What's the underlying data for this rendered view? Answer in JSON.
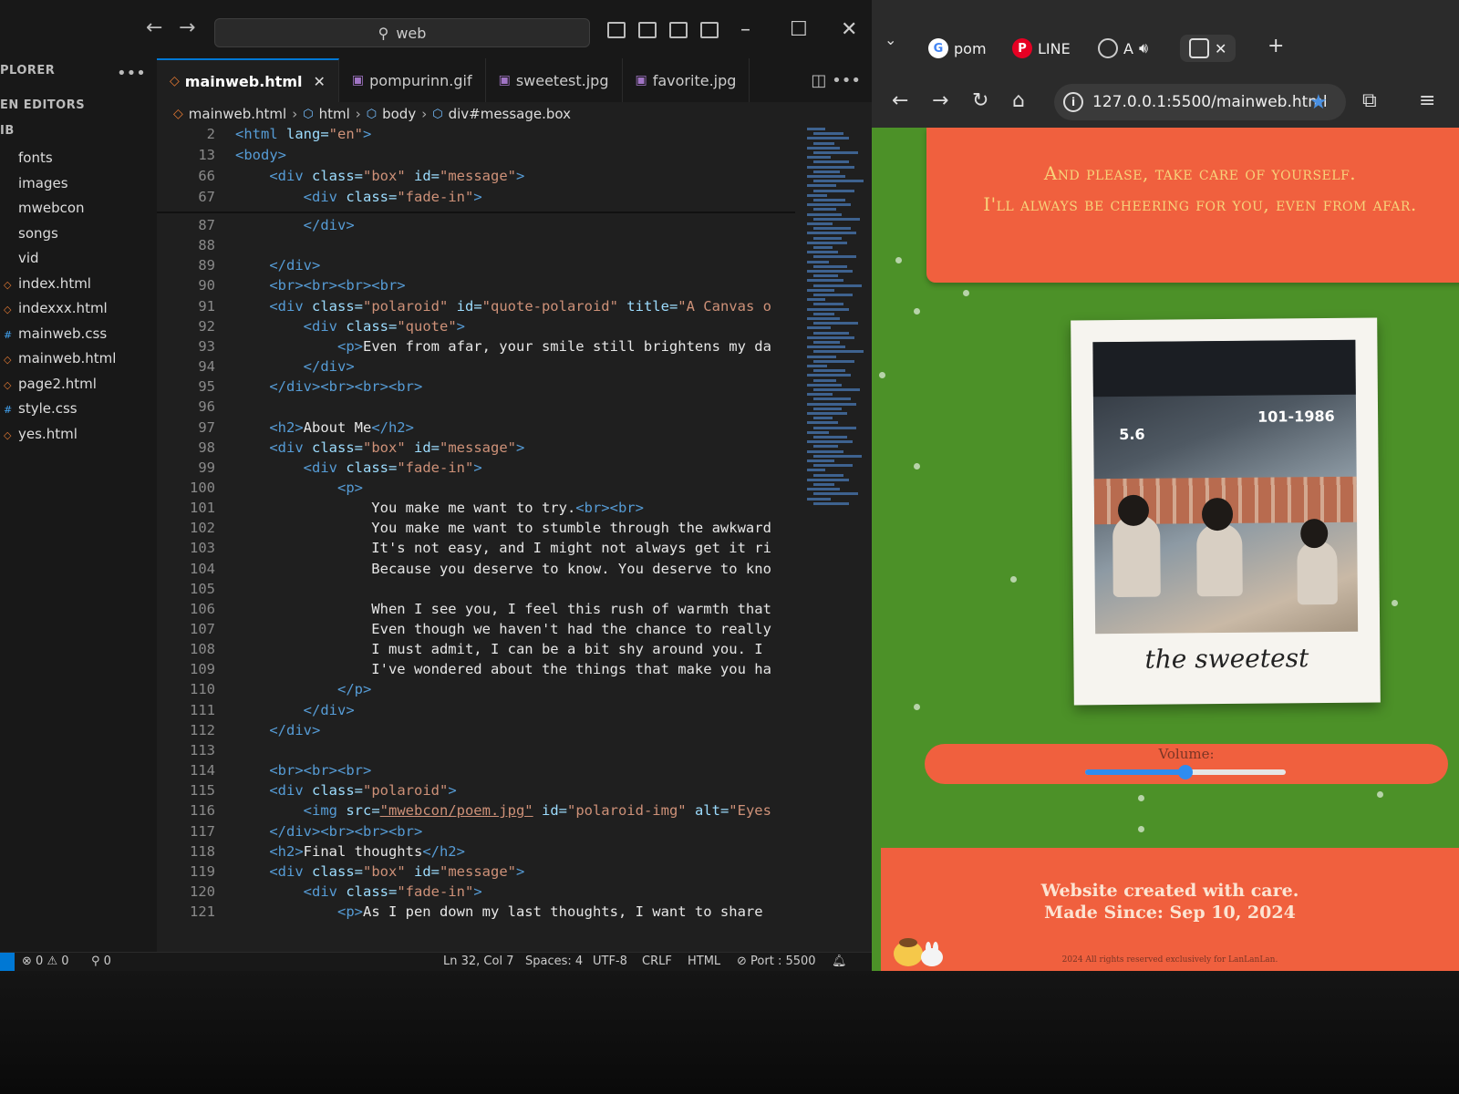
{
  "vscode": {
    "search_text": "web",
    "explorer": {
      "title": "PLORER",
      "open_editors": "EN EDITORS",
      "folder": "IB",
      "items": [
        "fonts",
        "images",
        "mwebcon",
        "songs",
        "vid",
        "index.html",
        "indexxx.html",
        "mainweb.css",
        "mainweb.html",
        "page2.html",
        "style.css",
        "yes.html"
      ]
    },
    "tabs": [
      "mainweb.html",
      "pompurinn.gif",
      "sweetest.jpg",
      "favorite.jpg"
    ],
    "breadcrumb": [
      "mainweb.html",
      "html",
      "body",
      "div#message.box"
    ],
    "code_lines": [
      {
        "n": "2",
        "s": [
          [
            "t",
            "<html "
          ],
          [
            "a",
            "lang="
          ],
          [
            "s",
            "\"en\""
          ],
          [
            "t",
            ">"
          ]
        ]
      },
      {
        "n": "13",
        "s": [
          [
            "t",
            "<body>"
          ]
        ]
      },
      {
        "n": "66",
        "s": [
          [
            "x",
            "    "
          ],
          [
            "t",
            "<div "
          ],
          [
            "a",
            "class="
          ],
          [
            "s",
            "\"box\" "
          ],
          [
            "a",
            "id="
          ],
          [
            "s",
            "\"message\""
          ],
          [
            "t",
            ">"
          ]
        ]
      },
      {
        "n": "67",
        "s": [
          [
            "x",
            "        "
          ],
          [
            "t",
            "<div "
          ],
          [
            "a",
            "class="
          ],
          [
            "s",
            "\"fade-in\""
          ],
          [
            "t",
            ">"
          ]
        ]
      },
      {
        "n": "87",
        "s": [
          [
            "x",
            "        "
          ],
          [
            "t",
            "</div>"
          ]
        ]
      },
      {
        "n": "88",
        "s": []
      },
      {
        "n": "89",
        "s": [
          [
            "x",
            "    "
          ],
          [
            "t",
            "</div>"
          ]
        ]
      },
      {
        "n": "90",
        "s": [
          [
            "x",
            "    "
          ],
          [
            "t",
            "<br><br><br><br>"
          ]
        ]
      },
      {
        "n": "91",
        "s": [
          [
            "x",
            "    "
          ],
          [
            "t",
            "<div "
          ],
          [
            "a",
            "class="
          ],
          [
            "s",
            "\"polaroid\" "
          ],
          [
            "a",
            "id="
          ],
          [
            "s",
            "\"quote-polaroid\" "
          ],
          [
            "a",
            "title="
          ],
          [
            "s",
            "\"A Canvas o"
          ]
        ]
      },
      {
        "n": "92",
        "s": [
          [
            "x",
            "        "
          ],
          [
            "t",
            "<div "
          ],
          [
            "a",
            "class="
          ],
          [
            "s",
            "\"quote\""
          ],
          [
            "t",
            ">"
          ]
        ]
      },
      {
        "n": "93",
        "s": [
          [
            "x",
            "            "
          ],
          [
            "t",
            "<p>"
          ],
          [
            "x",
            "Even from afar, your smile still brightens my da"
          ]
        ]
      },
      {
        "n": "94",
        "s": [
          [
            "x",
            "        "
          ],
          [
            "t",
            "</div>"
          ]
        ]
      },
      {
        "n": "95",
        "s": [
          [
            "x",
            "    "
          ],
          [
            "t",
            "</div><br><br><br>"
          ]
        ]
      },
      {
        "n": "96",
        "s": []
      },
      {
        "n": "97",
        "s": [
          [
            "x",
            "    "
          ],
          [
            "t",
            "<h2>"
          ],
          [
            "x",
            "About Me"
          ],
          [
            "t",
            "</h2>"
          ]
        ]
      },
      {
        "n": "98",
        "s": [
          [
            "x",
            "    "
          ],
          [
            "t",
            "<div "
          ],
          [
            "a",
            "class="
          ],
          [
            "s",
            "\"box\" "
          ],
          [
            "a",
            "id="
          ],
          [
            "s",
            "\"message\""
          ],
          [
            "t",
            ">"
          ]
        ]
      },
      {
        "n": "99",
        "s": [
          [
            "x",
            "        "
          ],
          [
            "t",
            "<div "
          ],
          [
            "a",
            "class="
          ],
          [
            "s",
            "\"fade-in\""
          ],
          [
            "t",
            ">"
          ]
        ]
      },
      {
        "n": "100",
        "s": [
          [
            "x",
            "            "
          ],
          [
            "t",
            "<p>"
          ]
        ]
      },
      {
        "n": "101",
        "s": [
          [
            "x",
            "                You make me want to try."
          ],
          [
            "t",
            "<br><br>"
          ]
        ]
      },
      {
        "n": "102",
        "s": [
          [
            "x",
            "                You make me want to stumble through the awkward"
          ]
        ]
      },
      {
        "n": "103",
        "s": [
          [
            "x",
            "                It's not easy, and I might not always get it ri"
          ]
        ]
      },
      {
        "n": "104",
        "s": [
          [
            "x",
            "                Because you deserve to know. You deserve to kno"
          ]
        ]
      },
      {
        "n": "105",
        "s": []
      },
      {
        "n": "106",
        "s": [
          [
            "x",
            "                When I see you, I feel this rush of warmth that"
          ]
        ]
      },
      {
        "n": "107",
        "s": [
          [
            "x",
            "                Even though we haven't had the chance to really"
          ]
        ]
      },
      {
        "n": "108",
        "s": [
          [
            "x",
            "                I must admit, I can be a bit shy around you. I"
          ]
        ]
      },
      {
        "n": "109",
        "s": [
          [
            "x",
            "                I've wondered about the things that make you ha"
          ]
        ]
      },
      {
        "n": "110",
        "s": [
          [
            "x",
            "            "
          ],
          [
            "t",
            "</p>"
          ]
        ]
      },
      {
        "n": "111",
        "s": [
          [
            "x",
            "        "
          ],
          [
            "t",
            "</div>"
          ]
        ]
      },
      {
        "n": "112",
        "s": [
          [
            "x",
            "    "
          ],
          [
            "t",
            "</div>"
          ]
        ]
      },
      {
        "n": "113",
        "s": []
      },
      {
        "n": "114",
        "s": [
          [
            "x",
            "    "
          ],
          [
            "t",
            "<br><br><br>"
          ]
        ]
      },
      {
        "n": "115",
        "s": [
          [
            "x",
            "    "
          ],
          [
            "t",
            "<div "
          ],
          [
            "a",
            "class="
          ],
          [
            "s",
            "\"polaroid\""
          ],
          [
            "t",
            ">"
          ]
        ]
      },
      {
        "n": "116",
        "s": [
          [
            "x",
            "        "
          ],
          [
            "t",
            "<img "
          ],
          [
            "a",
            "src="
          ],
          [
            "l",
            "\"mwebcon/poem.jpg\""
          ],
          [
            "x",
            " "
          ],
          [
            "a",
            "id="
          ],
          [
            "s",
            "\"polaroid-img\" "
          ],
          [
            "a",
            "alt="
          ],
          [
            "s",
            "\"Eyes"
          ]
        ]
      },
      {
        "n": "117",
        "s": [
          [
            "x",
            "    "
          ],
          [
            "t",
            "</div><br><br><br>"
          ]
        ]
      },
      {
        "n": "118",
        "s": [
          [
            "x",
            "    "
          ],
          [
            "t",
            "<h2>"
          ],
          [
            "x",
            "Final thoughts"
          ],
          [
            "t",
            "</h2>"
          ]
        ]
      },
      {
        "n": "119",
        "s": [
          [
            "x",
            "    "
          ],
          [
            "t",
            "<div "
          ],
          [
            "a",
            "class="
          ],
          [
            "s",
            "\"box\" "
          ],
          [
            "a",
            "id="
          ],
          [
            "s",
            "\"message\""
          ],
          [
            "t",
            ">"
          ]
        ]
      },
      {
        "n": "120",
        "s": [
          [
            "x",
            "        "
          ],
          [
            "t",
            "<div "
          ],
          [
            "a",
            "class="
          ],
          [
            "s",
            "\"fade-in\""
          ],
          [
            "t",
            ">"
          ]
        ]
      },
      {
        "n": "121",
        "s": [
          [
            "x",
            "            "
          ],
          [
            "t",
            "<p>"
          ],
          [
            "x",
            "As I pen down my last thoughts, I want to share"
          ]
        ]
      }
    ],
    "status": {
      "errors": "0",
      "warnings": "0",
      "ports": "0",
      "position": "Ln 32, Col 7",
      "spaces": "Spaces: 4",
      "encoding": "UTF-8",
      "eol": "CRLF",
      "language": "HTML",
      "port": "Port : 5500"
    }
  },
  "browser": {
    "tabs": [
      {
        "label": "pom",
        "favicon": "G"
      },
      {
        "label": "LINE",
        "favicon": "P"
      },
      {
        "label": "A",
        "favicon": ""
      }
    ],
    "url": "127.0.0.1:5500/mainweb.html",
    "page": {
      "message_line1": "And please, take care of yourself.",
      "message_line2": "I'll always be cheering for you, even from afar.",
      "photo_label_left": "5.6",
      "photo_label_right": "101-1986",
      "polaroid_caption": "the sweetest",
      "volume_label": "Volume:",
      "volume_level": 0.5,
      "footer_line1": "Website created with care.",
      "footer_line2": "Made Since: Sep 10, 2024",
      "footer_small": "2024 All rights reserved exclusively for LanLanLan."
    }
  },
  "colors": {
    "page_background": "#4c9128",
    "box_color": "#f0603e",
    "accent_blue": "#0078d4"
  }
}
